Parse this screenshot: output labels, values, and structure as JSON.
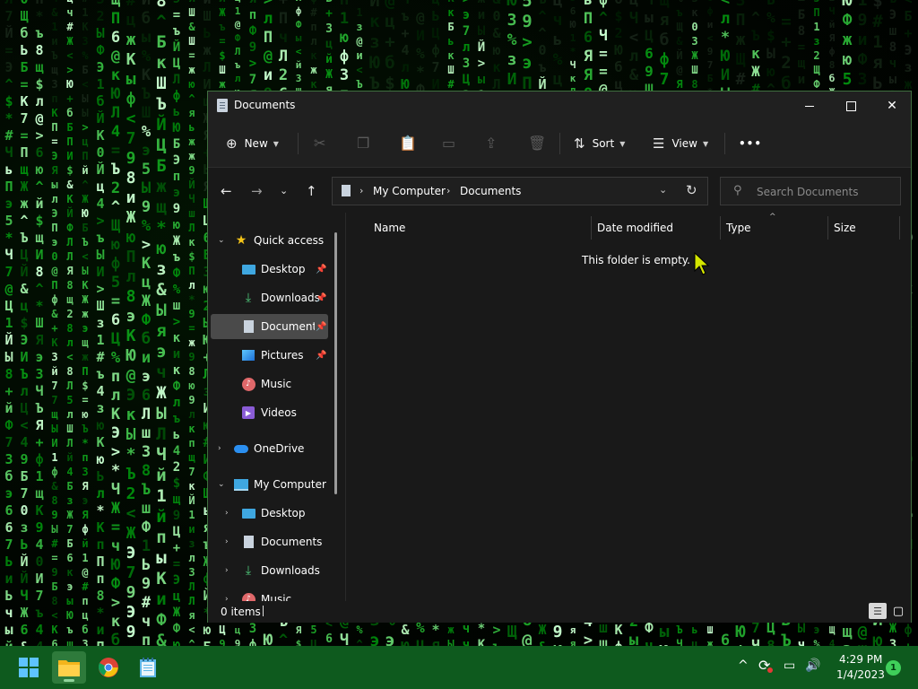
{
  "window": {
    "title": "Documents"
  },
  "commandbar": {
    "new_label": "New",
    "sort_label": "Sort",
    "view_label": "View",
    "more_label": "•••"
  },
  "address": {
    "crumbs": [
      "My Computer",
      "Documents"
    ],
    "search_placeholder": "Search Documents"
  },
  "navpane": {
    "quick_access": "Quick access",
    "quick_items": [
      "Desktop",
      "Downloads",
      "Documents",
      "Pictures",
      "Music",
      "Videos"
    ],
    "onedrive": "OneDrive",
    "my_computer": "My Computer",
    "computer_items": [
      "Desktop",
      "Documents",
      "Downloads",
      "Music"
    ]
  },
  "content": {
    "columns": [
      "Name",
      "Date modified",
      "Type",
      "Size"
    ],
    "empty_message": "This folder is empty."
  },
  "statusbar": {
    "items_count": "0 items"
  },
  "taskbar": {
    "time": "4:29 PM",
    "date": "1/4/2023",
    "notification_count": "1"
  },
  "colors": {
    "taskbar": "#0e5a1e",
    "window_bg": "#191919",
    "rain_green": "#39ff66"
  }
}
